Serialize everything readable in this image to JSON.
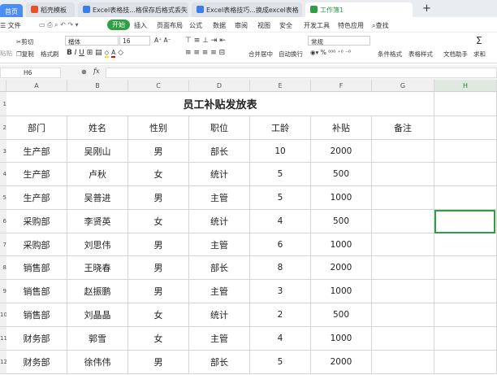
{
  "tabs": [
    {
      "label": "首页"
    },
    {
      "label": "稻壳模板"
    },
    {
      "label": "Excel表格技...格保存后格式丢失"
    },
    {
      "label": "Excel表格技巧...换成excel表格"
    },
    {
      "label": "工作簿1"
    }
  ],
  "menu": {
    "file": "文件",
    "items": [
      "开始",
      "插入",
      "页面布局",
      "公式",
      "数据",
      "审阅",
      "视图",
      "安全",
      "开发工具",
      "特色应用"
    ],
    "search": "查找"
  },
  "toolbar": {
    "cut": "剪切",
    "copy": "复制",
    "paste": "粘贴",
    "format_painter": "格式刷",
    "font": "楷体",
    "size": "16",
    "merge": "合并居中",
    "wrap": "自动换行",
    "number_format": "常规",
    "cond_format": "条件格式",
    "table_style": "表格样式",
    "doc_helper": "文档助手",
    "sum": "求和"
  },
  "formula": {
    "cell_ref": "H6",
    "fx": "fx",
    "value": ""
  },
  "columns": [
    "A",
    "B",
    "C",
    "D",
    "E",
    "F",
    "G",
    "H"
  ],
  "rows": [
    "1",
    "2",
    "3",
    "4",
    "5",
    "6",
    "7",
    "8",
    "9",
    "10",
    "11",
    "12"
  ],
  "sheet": {
    "title": "员工补贴发放表",
    "headers": [
      "部门",
      "姓名",
      "性别",
      "职位",
      "工龄",
      "补贴",
      "备注"
    ],
    "data": [
      [
        "生产部",
        "吴刚山",
        "男",
        "部长",
        "10",
        "2000",
        ""
      ],
      [
        "生产部",
        "卢秋",
        "女",
        "统计",
        "5",
        "500",
        ""
      ],
      [
        "生产部",
        "吴普进",
        "男",
        "主管",
        "5",
        "1000",
        ""
      ],
      [
        "采购部",
        "李贤英",
        "女",
        "统计",
        "4",
        "500",
        ""
      ],
      [
        "采购部",
        "刘思伟",
        "男",
        "主管",
        "6",
        "1000",
        ""
      ],
      [
        "销售部",
        "王晓春",
        "男",
        "部长",
        "8",
        "2000",
        ""
      ],
      [
        "销售部",
        "赵振鹏",
        "男",
        "主管",
        "3",
        "1000",
        ""
      ],
      [
        "销售部",
        "刘晶晶",
        "女",
        "统计",
        "2",
        "500",
        ""
      ],
      [
        "财务部",
        "郭雪",
        "女",
        "主管",
        "4",
        "1000",
        ""
      ],
      [
        "财务部",
        "徐伟伟",
        "男",
        "部长",
        "5",
        "2000",
        ""
      ]
    ]
  },
  "colors": {
    "accent": "#2f9e44",
    "home_tab": "#4a8ef5"
  }
}
